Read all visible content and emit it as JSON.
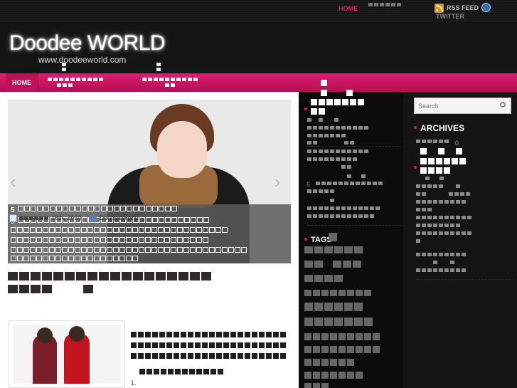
{
  "topbar": {
    "home_label": "HOME",
    "rss_label": "RSS FEED",
    "twitter_label": "TWITTER"
  },
  "header": {
    "site_title": "Doodee WORLD",
    "site_url": "www.doodeeworld.com"
  },
  "nav": {
    "home_label": "HOME"
  },
  "slider": {
    "caption_title": "5",
    "caption_number": "5"
  },
  "post": {
    "date": "18th, 2010",
    "author": "DoodeeWorld",
    "list_number": "1."
  },
  "sidebar": {
    "search_placeholder": "Search",
    "archives_title": "ARCHIVES",
    "archives_count": "0",
    "tags_title": "TAGS",
    "mid_list_number": "6"
  },
  "colors": {
    "accent": "#e0186c",
    "nav": "#c9145f",
    "background": "#141414"
  }
}
